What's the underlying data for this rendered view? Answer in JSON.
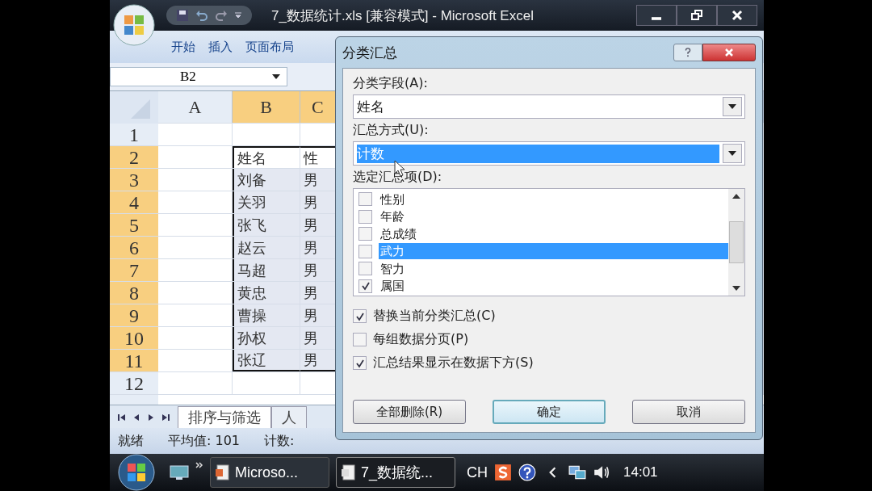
{
  "window": {
    "title": "7_数据统计.xls  [兼容模式] - Microsoft Excel"
  },
  "ribbon_tabs": [
    {
      "label": "开始",
      "selected": false
    },
    {
      "label": "插入",
      "selected": false
    },
    {
      "label": "页面布局",
      "selected": false
    }
  ],
  "name_box": "B2",
  "columns": [
    {
      "label": "A",
      "selected": false
    },
    {
      "label": "B",
      "selected": true
    },
    {
      "label": "C",
      "selected": true
    }
  ],
  "rows": [
    {
      "number": "1",
      "selected": false,
      "cells": [
        "",
        "",
        ""
      ]
    },
    {
      "number": "2",
      "selected": true,
      "cells": [
        "",
        "姓名",
        "性"
      ]
    },
    {
      "number": "3",
      "selected": true,
      "cells": [
        "",
        "刘备",
        "男"
      ]
    },
    {
      "number": "4",
      "selected": true,
      "cells": [
        "",
        "关羽",
        "男"
      ]
    },
    {
      "number": "5",
      "selected": true,
      "cells": [
        "",
        "张飞",
        "男"
      ]
    },
    {
      "number": "6",
      "selected": true,
      "cells": [
        "",
        "赵云",
        "男"
      ]
    },
    {
      "number": "7",
      "selected": true,
      "cells": [
        "",
        "马超",
        "男"
      ]
    },
    {
      "number": "8",
      "selected": true,
      "cells": [
        "",
        "黄忠",
        "男"
      ]
    },
    {
      "number": "9",
      "selected": true,
      "cells": [
        "",
        "曹操",
        "男"
      ]
    },
    {
      "number": "10",
      "selected": true,
      "cells": [
        "",
        "孙权",
        "男"
      ]
    },
    {
      "number": "11",
      "selected": true,
      "cells": [
        "",
        "张辽",
        "男"
      ]
    },
    {
      "number": "12",
      "selected": false,
      "cells": [
        "",
        "",
        ""
      ]
    }
  ],
  "sheet_tabs": [
    {
      "label": "排序与筛选",
      "selected": true
    },
    {
      "label": "人",
      "selected": false
    }
  ],
  "status_bar": [
    "就绪",
    "平均值: 101",
    "计数:"
  ],
  "dialog": {
    "title": "分类汇总",
    "field_label": "分类字段(A):",
    "field_value": "姓名",
    "method_label": "汇总方式(U):",
    "method_value": "计数",
    "method_selected": true,
    "items_label": "选定汇总项(D):",
    "items": [
      {
        "label": "性别",
        "checked": false,
        "selected": false
      },
      {
        "label": "年龄",
        "checked": false,
        "selected": false
      },
      {
        "label": "总成绩",
        "checked": false,
        "selected": false
      },
      {
        "label": "武力",
        "checked": false,
        "selected": true
      },
      {
        "label": "智力",
        "checked": false,
        "selected": false
      },
      {
        "label": "属国",
        "checked": true,
        "selected": false
      }
    ],
    "options": [
      {
        "label": "替换当前分类汇总(C)",
        "checked": true
      },
      {
        "label": "每组数据分页(P)",
        "checked": false
      },
      {
        "label": "汇总结果显示在数据下方(S)",
        "checked": true
      }
    ],
    "buttons": [
      {
        "label": "全部删除(R)",
        "kind": "plain"
      },
      {
        "label": "确定",
        "kind": "default"
      },
      {
        "label": "取消",
        "kind": "plain"
      }
    ]
  },
  "taskbar": {
    "buttons": [
      {
        "label": "Microso...",
        "selected": false
      },
      {
        "label": "7_数据统...",
        "selected": true
      }
    ],
    "language": "CH",
    "clock": "14:01"
  }
}
